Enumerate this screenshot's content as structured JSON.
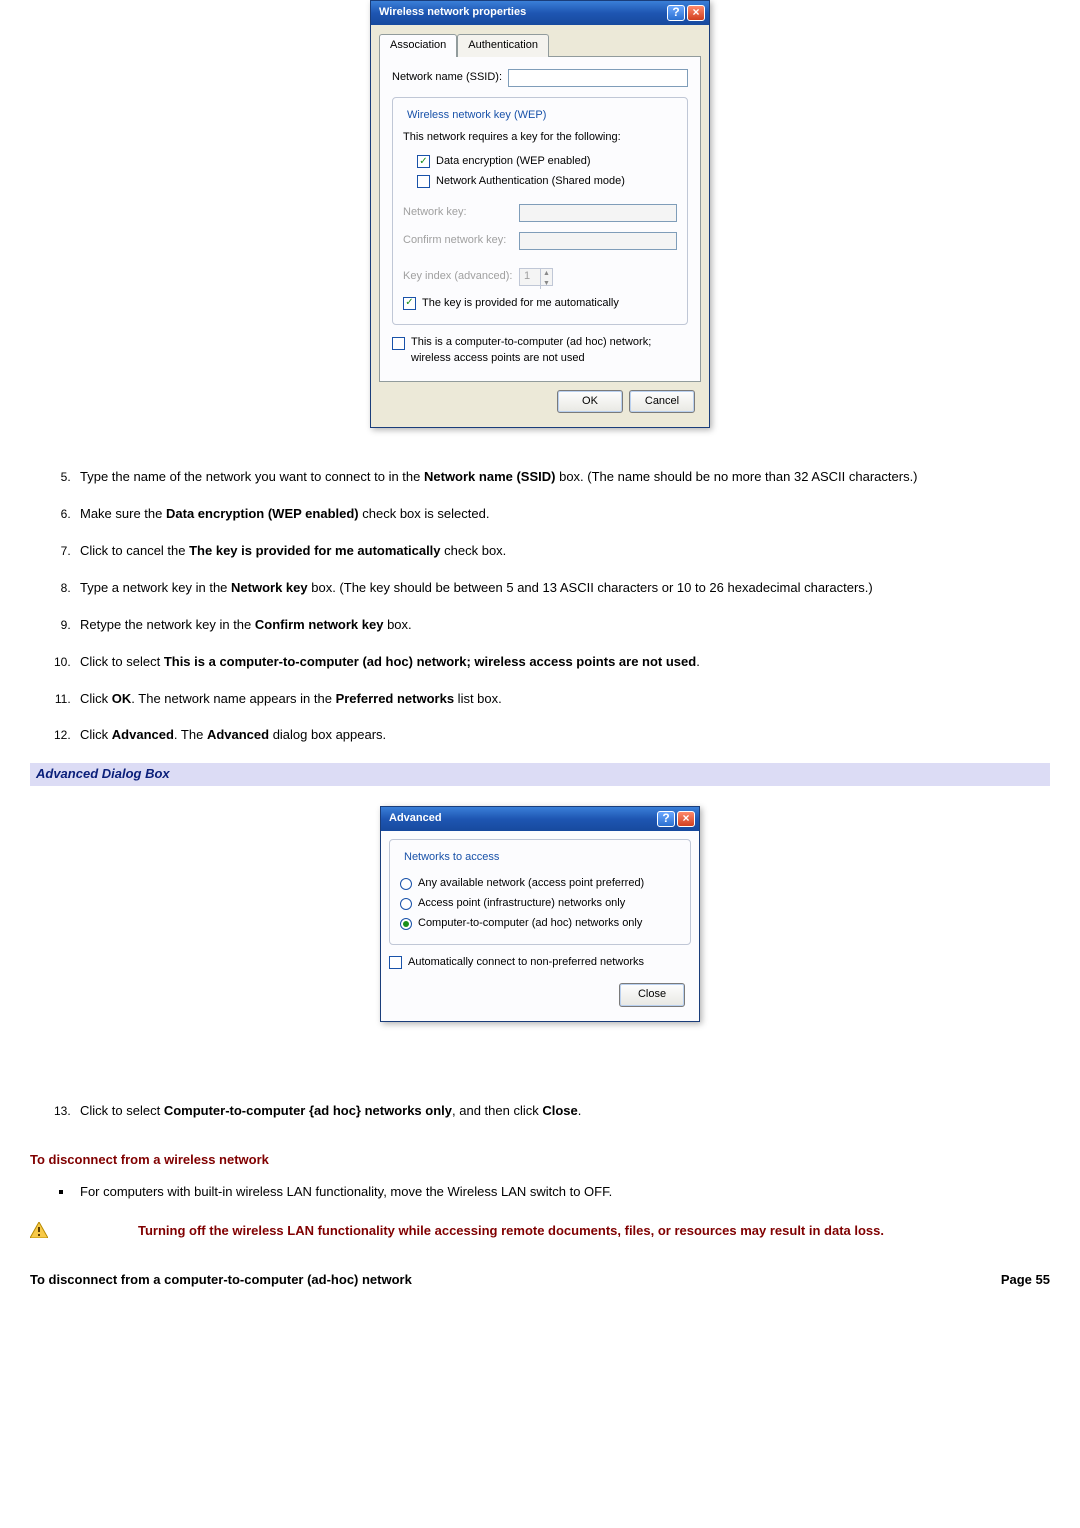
{
  "dialog1": {
    "title": "Wireless network properties",
    "tabs": {
      "assoc": "Association",
      "auth": "Authentication"
    },
    "ssid_label": "Network name (SSID):",
    "wep_group": "Wireless network key (WEP)",
    "wep_intro": "This network requires a key for the following:",
    "wep_cb1": "Data encryption (WEP enabled)",
    "wep_cb2": "Network Authentication (Shared mode)",
    "netkey_label": "Network key:",
    "confirm_label": "Confirm network key:",
    "keyidx_label": "Key index (advanced):",
    "keyidx_value": "1",
    "auto_cb": "The key is provided for me automatically",
    "adhoc_cb": "This is a computer-to-computer (ad hoc) network; wireless access points are not used",
    "ok": "OK",
    "cancel": "Cancel"
  },
  "steps1": {
    "s5a": "Type the name of the network you want to connect to in the ",
    "s5b": "Network name (SSID)",
    "s5c": " box. (The name should be no more than 32 ASCII characters.)",
    "s6a": "Make sure the ",
    "s6b": "Data encryption (WEP enabled)",
    "s6c": " check box is selected.",
    "s7a": "Click to cancel the ",
    "s7b": "The key is provided for me automatically",
    "s7c": " check box.",
    "s8a": "Type a network key in the ",
    "s8b": "Network key",
    "s8c": " box. (The key should be between 5 and 13 ASCII characters or 10 to 26 hexadecimal characters.)",
    "s9a": "Retype the network key in the ",
    "s9b": "Confirm network key",
    "s9c": " box.",
    "s10a": "Click to select ",
    "s10b": "This is a computer-to-computer (ad hoc) network; wireless access points are not used",
    "s10c": ".",
    "s11a": "Click ",
    "s11b": "OK",
    "s11c": ". The network name appears in the ",
    "s11d": "Preferred networks",
    "s11e": " list box.",
    "s12a": "Click ",
    "s12b": "Advanced",
    "s12c": ". The ",
    "s12d": "Advanced",
    "s12e": " dialog box appears."
  },
  "banner1": "Advanced Dialog Box",
  "dialog2": {
    "title": "Advanced",
    "group": "Networks to access",
    "r1": "Any available network (access point preferred)",
    "r2": "Access point (infrastructure) networks only",
    "r3": "Computer-to-computer (ad hoc) networks only",
    "auto_cb": "Automatically connect to non-preferred networks",
    "close": "Close"
  },
  "steps2": {
    "s13a": "Click to select ",
    "s13b": "Computer-to-computer {ad hoc} networks only",
    "s13c": ", and then click ",
    "s13d": "Close",
    "s13e": "."
  },
  "disconnect_head": "To disconnect from a wireless network",
  "disconnect_bullet": "For computers with built-in wireless LAN functionality, move the Wireless LAN switch to OFF.",
  "warn_text": "Turning off the wireless LAN functionality while accessing remote documents, files, or resources may result in data loss.",
  "footer": {
    "left": "To disconnect from a computer-to-computer (ad-hoc) network",
    "right": "Page 55"
  }
}
